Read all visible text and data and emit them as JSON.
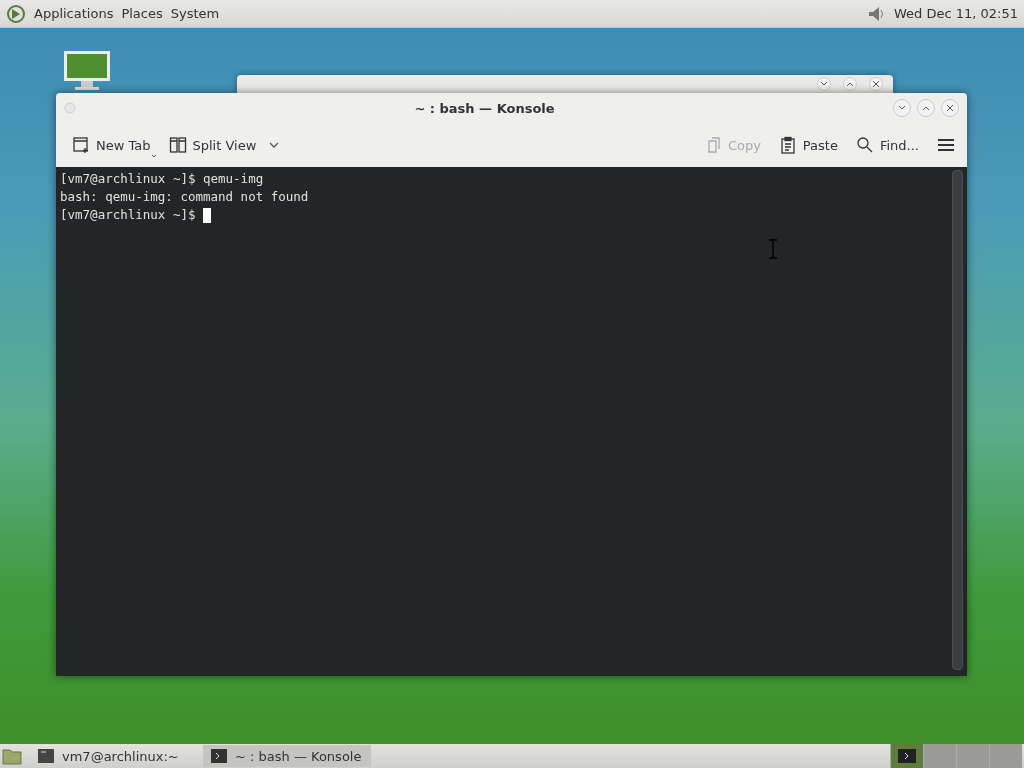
{
  "top_panel": {
    "menus": [
      "Applications",
      "Places",
      "System"
    ],
    "clock": "Wed Dec 11, 02:51"
  },
  "konsole": {
    "title": "~ : bash — Konsole",
    "toolbar": [
      {
        "kind": "new-tab",
        "label": "New Tab",
        "disabled": false
      },
      {
        "kind": "split",
        "label": "Split View",
        "disabled": false
      },
      {
        "kind": "copy",
        "label": "Copy",
        "disabled": true
      },
      {
        "kind": "paste",
        "label": "Paste",
        "disabled": false
      },
      {
        "kind": "find",
        "label": "Find...",
        "disabled": false
      }
    ],
    "terminal_lines": [
      {
        "text": "[vm7@archlinux ~]$ qemu-img",
        "cursor": false
      },
      {
        "text": "bash: qemu-img: command not found",
        "cursor": false
      },
      {
        "text": "[vm7@archlinux ~]$ ",
        "cursor": true
      }
    ]
  },
  "taskbar": {
    "tasks": [
      {
        "label": "vm7@archlinux:~",
        "selected": false
      },
      {
        "label": "~ : bash — Konsole",
        "selected": true
      }
    ],
    "workspaces": [
      {
        "selected": true
      },
      {
        "selected": false
      },
      {
        "selected": false
      },
      {
        "selected": false
      }
    ]
  }
}
